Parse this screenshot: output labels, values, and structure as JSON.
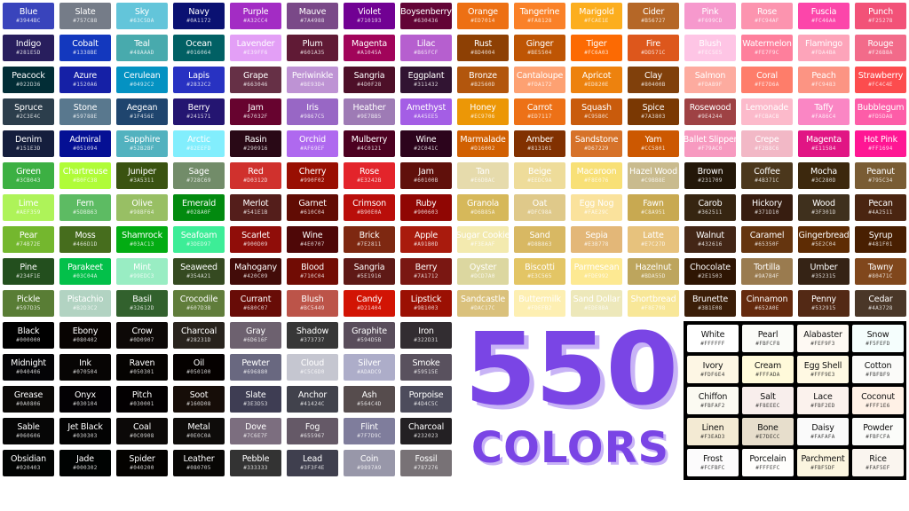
{
  "headline": {
    "number": "550",
    "word": "COLORS"
  },
  "colors": {
    "accent": "#7A45E5",
    "accent_shadow": "#C8B3F6"
  },
  "groups": [
    {
      "id": "blues",
      "swatches": [
        {
          "n": "Blue",
          "h": "#3944BC"
        },
        {
          "n": "Slate",
          "h": "#757C88"
        },
        {
          "n": "Sky",
          "h": "#63C5DA"
        },
        {
          "n": "Navy",
          "h": "#0A1172"
        },
        {
          "n": "Indigo",
          "h": "#281E5D"
        },
        {
          "n": "Cobalt",
          "h": "#1338BE"
        },
        {
          "n": "Teal",
          "h": "#48AAAD"
        },
        {
          "n": "Ocean",
          "h": "#016064"
        },
        {
          "n": "Peacock",
          "h": "#022D36"
        },
        {
          "n": "Azure",
          "h": "#1520A6"
        },
        {
          "n": "Cerulean",
          "h": "#0492C2"
        },
        {
          "n": "Lapis",
          "h": "#2832C2"
        },
        {
          "n": "Spruce",
          "h": "#2C3E4C"
        },
        {
          "n": "Stone",
          "h": "#59788E"
        },
        {
          "n": "Aegean",
          "h": "#1F456E"
        },
        {
          "n": "Berry",
          "h": "#241571"
        },
        {
          "n": "Denim",
          "h": "#151E3D"
        },
        {
          "n": "Admiral",
          "h": "#051094"
        },
        {
          "n": "Sapphire",
          "h": "#52B2BF"
        },
        {
          "n": "Arctic",
          "h": "#82EEFD"
        }
      ]
    },
    {
      "id": "purples",
      "swatches": [
        {
          "n": "Purple",
          "h": "#A32CC4"
        },
        {
          "n": "Mauve",
          "h": "#7A4988"
        },
        {
          "n": "Violet",
          "h": "#710193"
        },
        {
          "n": "Boysenberry",
          "h": "#630436"
        },
        {
          "n": "Lavender",
          "h": "#E39FF6"
        },
        {
          "n": "Plum",
          "h": "#601A35"
        },
        {
          "n": "Magenta",
          "h": "#A1045A"
        },
        {
          "n": "Lilac",
          "h": "#B65FCF"
        },
        {
          "n": "Grape",
          "h": "#663046"
        },
        {
          "n": "Periwinkle",
          "h": "#BE93D4"
        },
        {
          "n": "Sangria",
          "h": "#4D0F28"
        },
        {
          "n": "Eggplant",
          "h": "#311432"
        },
        {
          "n": "Jam",
          "h": "#67032F"
        },
        {
          "n": "Iris",
          "h": "#9867C5"
        },
        {
          "n": "Heather",
          "h": "#9E7BB5"
        },
        {
          "n": "Amethyst",
          "h": "#A45EE5"
        },
        {
          "n": "Rasin",
          "h": "#290916"
        },
        {
          "n": "Orchid",
          "h": "#AF69EF"
        },
        {
          "n": "Mulberry",
          "h": "#4C0121"
        },
        {
          "n": "Wine",
          "h": "#2C041C"
        }
      ]
    },
    {
      "id": "oranges",
      "swatches": [
        {
          "n": "Orange",
          "h": "#ED7014"
        },
        {
          "n": "Tangerine",
          "h": "#FA8128"
        },
        {
          "n": "Marigold",
          "h": "#FCAE1E"
        },
        {
          "n": "Cider",
          "h": "#B56727"
        },
        {
          "n": "Rust",
          "h": "#8D4004"
        },
        {
          "n": "Ginger",
          "h": "#BE5504"
        },
        {
          "n": "Tiger",
          "h": "#FC6A03"
        },
        {
          "n": "Fire",
          "h": "#DD571C"
        },
        {
          "n": "Bronze",
          "h": "#B2560D"
        },
        {
          "n": "Cantaloupe",
          "h": "#FDA172"
        },
        {
          "n": "Apricot",
          "h": "#ED820E"
        },
        {
          "n": "Clay",
          "h": "#80400B"
        },
        {
          "n": "Honey",
          "h": "#EC9706"
        },
        {
          "n": "Carrot",
          "h": "#ED7117"
        },
        {
          "n": "Squash",
          "h": "#C95B0C"
        },
        {
          "n": "Spice",
          "h": "#7A3803"
        },
        {
          "n": "Marmalade",
          "h": "#D16002"
        },
        {
          "n": "Amber",
          "h": "#813101"
        },
        {
          "n": "Sandstone",
          "h": "#D67229"
        },
        {
          "n": "Yam",
          "h": "#CC5801"
        }
      ]
    },
    {
      "id": "pinks",
      "swatches": [
        {
          "n": "Pink",
          "h": "#F699CD"
        },
        {
          "n": "Rose",
          "h": "#FC94AF"
        },
        {
          "n": "Fuscia",
          "h": "#FC46AA"
        },
        {
          "n": "Punch",
          "h": "#F25278"
        },
        {
          "n": "Blush",
          "h": "#FEC5E5"
        },
        {
          "n": "Watermelon",
          "h": "#FE7F9C"
        },
        {
          "n": "Flamingo",
          "h": "#FDA4BA"
        },
        {
          "n": "Rouge",
          "h": "#F26B8A"
        },
        {
          "n": "Salmon",
          "h": "#FDAB9F"
        },
        {
          "n": "Coral",
          "h": "#FE7D6A"
        },
        {
          "n": "Peach",
          "h": "#FC9483"
        },
        {
          "n": "Strawberry",
          "h": "#FC4C4E"
        },
        {
          "n": "Rosewood",
          "h": "#9E4244"
        },
        {
          "n": "Lemonade",
          "h": "#FCBACB"
        },
        {
          "n": "Taffy",
          "h": "#FA86C4"
        },
        {
          "n": "Bubblegum",
          "h": "#FD5DA8"
        },
        {
          "n": "Ballet Slipper",
          "h": "#F79AC0"
        },
        {
          "n": "Crepe",
          "h": "#F2B8C6"
        },
        {
          "n": "Magenta",
          "h": "#E11584"
        },
        {
          "n": "Hot Pink",
          "h": "#FF1694"
        }
      ]
    },
    {
      "id": "greens",
      "swatches": [
        {
          "n": "Green",
          "h": "#3CB043"
        },
        {
          "n": "Chartreuse",
          "h": "#B0FC38"
        },
        {
          "n": "Juniper",
          "h": "#3A5311"
        },
        {
          "n": "Sage",
          "h": "#728C69"
        },
        {
          "n": "Lime",
          "h": "#AEF359"
        },
        {
          "n": "Fern",
          "h": "#5DBB63"
        },
        {
          "n": "Olive",
          "h": "#98BF64"
        },
        {
          "n": "Emerald",
          "h": "#028A0F"
        },
        {
          "n": "Pear",
          "h": "#74B72E"
        },
        {
          "n": "Moss",
          "h": "#466D1D"
        },
        {
          "n": "Shamrock",
          "h": "#03AC13"
        },
        {
          "n": "Seafoam",
          "h": "#3DED97"
        },
        {
          "n": "Pine",
          "h": "#234F1E"
        },
        {
          "n": "Parakeet",
          "h": "#03C04A"
        },
        {
          "n": "Mint",
          "h": "#99EDC3"
        },
        {
          "n": "Seaweed",
          "h": "#354A21"
        },
        {
          "n": "Pickle",
          "h": "#597D35"
        },
        {
          "n": "Pistachio",
          "h": "#B2D3C2"
        },
        {
          "n": "Basil",
          "h": "#32612D"
        },
        {
          "n": "Crocodile",
          "h": "#607D3B"
        }
      ]
    },
    {
      "id": "reds",
      "swatches": [
        {
          "n": "Red",
          "h": "#D0312D"
        },
        {
          "n": "Cherry",
          "h": "#990F02"
        },
        {
          "n": "Rose",
          "h": "#E3242B"
        },
        {
          "n": "Jam",
          "h": "#60100B"
        },
        {
          "n": "Merlot",
          "h": "#541E1B"
        },
        {
          "n": "Garnet",
          "h": "#610C04"
        },
        {
          "n": "Crimson",
          "h": "#B90E0A"
        },
        {
          "n": "Ruby",
          "h": "#900603"
        },
        {
          "n": "Scarlet",
          "h": "#900D09"
        },
        {
          "n": "Wine",
          "h": "#4E0707"
        },
        {
          "n": "Brick",
          "h": "#7E2811"
        },
        {
          "n": "Apple",
          "h": "#A91B0D"
        },
        {
          "n": "Mahogany",
          "h": "#420C09"
        },
        {
          "n": "Blood",
          "h": "#710C04"
        },
        {
          "n": "Sangria",
          "h": "#5E1916"
        },
        {
          "n": "Berry",
          "h": "#7A1712"
        },
        {
          "n": "Currant",
          "h": "#680C07"
        },
        {
          "n": "Blush",
          "h": "#BC5449"
        },
        {
          "n": "Candy",
          "h": "#D21404"
        },
        {
          "n": "Lipstick",
          "h": "#9B1003"
        }
      ]
    },
    {
      "id": "yellows",
      "swatches": [
        {
          "n": "Tan",
          "h": "#E6DBAC"
        },
        {
          "n": "Beige",
          "h": "#EEDC9A"
        },
        {
          "n": "Macaroon",
          "h": "#F8E076"
        },
        {
          "n": "Hazel Wood",
          "h": "#C9BB8E"
        },
        {
          "n": "Granola",
          "h": "#D6B85A"
        },
        {
          "n": "Oat",
          "h": "#DFC98A"
        },
        {
          "n": "Egg Nog",
          "h": "#FAE29C"
        },
        {
          "n": "Fawn",
          "h": "#C8A951"
        },
        {
          "n": "Sugar Cookie",
          "h": "#F3EAAF"
        },
        {
          "n": "Sand",
          "h": "#D8B863"
        },
        {
          "n": "Sepia",
          "h": "#E3B778"
        },
        {
          "n": "Latte",
          "h": "#E7C27D"
        },
        {
          "n": "Oyster",
          "h": "#DCD7A0"
        },
        {
          "n": "Biscotti",
          "h": "#E3C565"
        },
        {
          "n": "Parmesean",
          "h": "#FDE992"
        },
        {
          "n": "Hazelnut",
          "h": "#BDA55D"
        },
        {
          "n": "Sandcastle",
          "h": "#DAC17C"
        },
        {
          "n": "Buttermilk",
          "h": "#FDEFB2"
        },
        {
          "n": "Sand Dollar",
          "h": "#EDE8BA"
        },
        {
          "n": "Shortbread",
          "h": "#F8E798"
        }
      ]
    },
    {
      "id": "browns",
      "swatches": [
        {
          "n": "Brown",
          "h": "#231709"
        },
        {
          "n": "Coffee",
          "h": "#4B371C"
        },
        {
          "n": "Mocha",
          "h": "#3C280D"
        },
        {
          "n": "Peanut",
          "h": "#795C34"
        },
        {
          "n": "Carob",
          "h": "#362511"
        },
        {
          "n": "Hickory",
          "h": "#371D10"
        },
        {
          "n": "Wood",
          "h": "#3F301D"
        },
        {
          "n": "Pecan",
          "h": "#4A2511"
        },
        {
          "n": "Walnut",
          "h": "#432616"
        },
        {
          "n": "Caramel",
          "h": "#65350F"
        },
        {
          "n": "Gingerbread",
          "h": "#5E2C04"
        },
        {
          "n": "Syrup",
          "h": "#481F01"
        },
        {
          "n": "Chocolate",
          "h": "#2E1503"
        },
        {
          "n": "Tortilla",
          "h": "#9A7B4F"
        },
        {
          "n": "Umber",
          "h": "#352315"
        },
        {
          "n": "Tawny",
          "h": "#80471C"
        },
        {
          "n": "Brunette",
          "h": "#3B1E08"
        },
        {
          "n": "Cinnamon",
          "h": "#652A0E"
        },
        {
          "n": "Penny",
          "h": "#532915"
        },
        {
          "n": "Cedar",
          "h": "#4A3728"
        }
      ]
    },
    {
      "id": "blacks",
      "swatches": [
        {
          "n": "Black",
          "h": "#000000"
        },
        {
          "n": "Ebony",
          "h": "#080402"
        },
        {
          "n": "Crow",
          "h": "#0D0907"
        },
        {
          "n": "Charcoal",
          "h": "#28231D"
        },
        {
          "n": "Midnight",
          "h": "#040406"
        },
        {
          "n": "Ink",
          "h": "#070504"
        },
        {
          "n": "Raven",
          "h": "#050301"
        },
        {
          "n": "Oil",
          "h": "#050100"
        },
        {
          "n": "Grease",
          "h": "#0A0806"
        },
        {
          "n": "Onyx",
          "h": "#030104"
        },
        {
          "n": "Pitch",
          "h": "#030001"
        },
        {
          "n": "Soot",
          "h": "#160D08"
        },
        {
          "n": "Sable",
          "h": "#060606"
        },
        {
          "n": "Jet Black",
          "h": "#030303"
        },
        {
          "n": "Coal",
          "h": "#0C0908"
        },
        {
          "n": "Metal",
          "h": "#0E0C0A"
        },
        {
          "n": "Obsidian",
          "h": "#020403"
        },
        {
          "n": "Jade",
          "h": "#000302"
        },
        {
          "n": "Spider",
          "h": "#040200"
        },
        {
          "n": "Leather",
          "h": "#080705"
        }
      ]
    },
    {
      "id": "grays",
      "swatches": [
        {
          "n": "Gray",
          "h": "#6D616F"
        },
        {
          "n": "Shadow",
          "h": "#373737"
        },
        {
          "n": "Graphite",
          "h": "#594D5B"
        },
        {
          "n": "Iron",
          "h": "#322D31"
        },
        {
          "n": "Pewter",
          "h": "#696880"
        },
        {
          "n": "Cloud",
          "h": "#C5C6D0"
        },
        {
          "n": "Silver",
          "h": "#ADADC9"
        },
        {
          "n": "Smoke",
          "h": "#59515E"
        },
        {
          "n": "Slate",
          "h": "#3E3D53"
        },
        {
          "n": "Anchor",
          "h": "#41424C"
        },
        {
          "n": "Ash",
          "h": "#564C4D"
        },
        {
          "n": "Porpoise",
          "h": "#4D4C5C"
        },
        {
          "n": "Dove",
          "h": "#7C6E7F"
        },
        {
          "n": "Fog",
          "h": "#655967"
        },
        {
          "n": "Flint",
          "h": "#7F7D9C"
        },
        {
          "n": "Charcoal",
          "h": "#232023"
        },
        {
          "n": "Pebble",
          "h": "#333333"
        },
        {
          "n": "Lead",
          "h": "#3F3F4E"
        },
        {
          "n": "Coin",
          "h": "#9897A9"
        },
        {
          "n": "Fossil",
          "h": "#787276"
        }
      ]
    },
    {
      "id": "whites",
      "swatches": [
        {
          "n": "White",
          "h": "#FFFFFF"
        },
        {
          "n": "Pearl",
          "h": "#FBFCF8"
        },
        {
          "n": "Alabaster",
          "h": "#FEF9F3"
        },
        {
          "n": "Snow",
          "h": "#F5FEFD"
        },
        {
          "n": "Ivory",
          "h": "#FDF6E4"
        },
        {
          "n": "Cream",
          "h": "#FFFADA"
        },
        {
          "n": "Egg Shell",
          "h": "#FFF9E3"
        },
        {
          "n": "Cotton",
          "h": "#FBFBF9"
        },
        {
          "n": "Chiffon",
          "h": "#FBFAF2"
        },
        {
          "n": "Salt",
          "h": "#F8EEEC"
        },
        {
          "n": "Lace",
          "h": "#FBF2ED"
        },
        {
          "n": "Coconut",
          "h": "#FFF1E6"
        },
        {
          "n": "Linen",
          "h": "#F3EAD3"
        },
        {
          "n": "Bone",
          "h": "#E7DECC"
        },
        {
          "n": "Daisy",
          "h": "#FAFAFA"
        },
        {
          "n": "Powder",
          "h": "#FBFCFA"
        },
        {
          "n": "Frost",
          "h": "#FCFBFC"
        },
        {
          "n": "Porcelain",
          "h": "#FFFEFC"
        },
        {
          "n": "Parchment",
          "h": "#FBF5DF"
        },
        {
          "n": "Rice",
          "h": "#FAF5EF"
        }
      ]
    }
  ]
}
